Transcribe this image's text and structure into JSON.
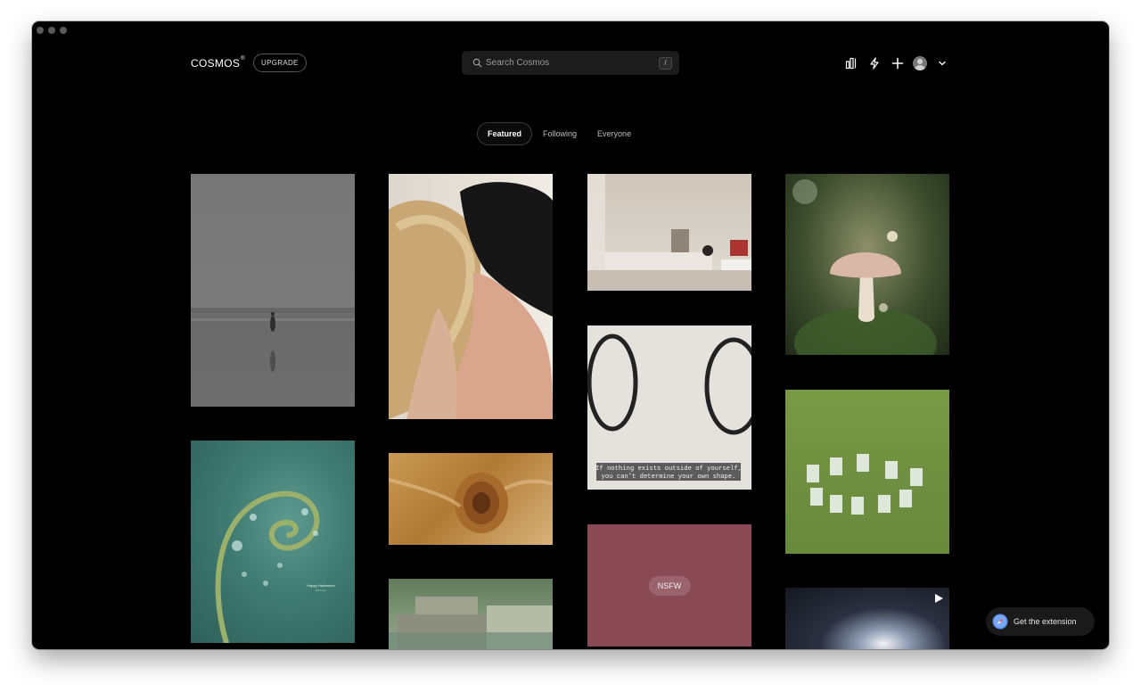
{
  "app": {
    "logo": "COSMOS",
    "logo_mark": "®",
    "upgrade_label": "UPGRADE"
  },
  "search": {
    "placeholder": "Search Cosmos",
    "shortcut": "/"
  },
  "header_icons": [
    "stats-icon",
    "lightning-icon",
    "plus-icon",
    "avatar",
    "chevron-down-icon"
  ],
  "tabs": [
    {
      "label": "Featured",
      "active": true
    },
    {
      "label": "Following",
      "active": false
    },
    {
      "label": "Everyone",
      "active": false
    }
  ],
  "grid": {
    "nsfw_label": "NSFW",
    "quote_line1": "If nothing exists outside of yourself,",
    "quote_line2": "you can't determine your own shape.",
    "fern_caption_line1": "Happy Halloween",
    "fern_caption_line2": "from me"
  },
  "extension": {
    "label": "Get the extension"
  },
  "colors": {
    "background": "#000000",
    "nsfw_card": "#8a4a55",
    "search_bg": "#1c1c1c"
  }
}
